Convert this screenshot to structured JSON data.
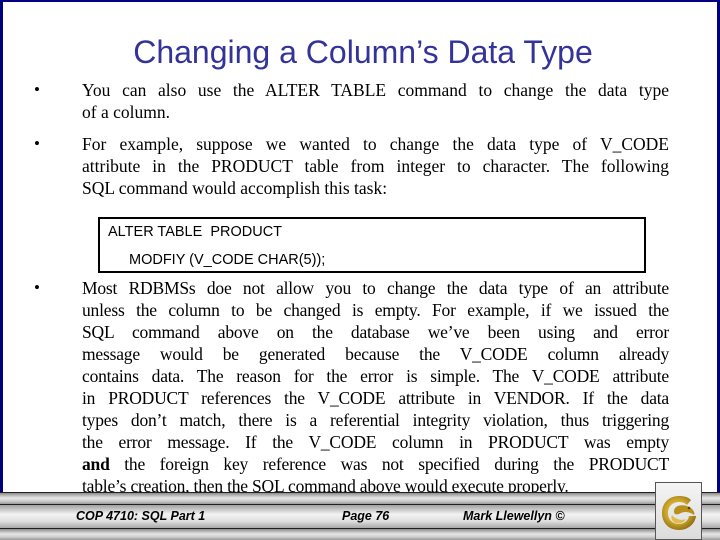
{
  "slide": {
    "title": "Changing a Column’s Data Type",
    "bullet_glyph": "•",
    "bullets": [
      {
        "lines": [
          "You can also use the ALTER TABLE command to change the data type",
          "of a column."
        ]
      },
      {
        "lines": [
          "For example, suppose we wanted to change the data type of V_CODE",
          "attribute in the PRODUCT table from integer to character.  The following",
          "SQL command would accomplish this task:"
        ]
      },
      {
        "lines": [
          "Most RDBMSs doe not allow you to change the data type of an attribute",
          "unless the column to be changed is empty.  For example, if we issued the",
          "SQL command above on the database we’ve been using and error",
          "message would be generated because the V_CODE column already",
          "contains data.  The reason for the error is simple.  The V_CODE attribute",
          "in PRODUCT references the V_CODE attribute in VENDOR.  If the data",
          "types don’t match, there is a referential integrity violation, thus triggering",
          "the error message.  If the V_CODE column in PRODUCT was empty"
        ],
        "bold_word": "and",
        "line9_rest": " the foreign key reference was not specified during the PRODUCT",
        "line10": "table’s creation, then the SQL command above would execute properly."
      }
    ],
    "code": {
      "line1": "ALTER TABLE  PRODUCT",
      "line2": "MODFIY (V_CODE CHAR(5));"
    }
  },
  "footer": {
    "course": "COP 4710: SQL Part 1",
    "page": "Page 76",
    "author": "Mark Llewellyn ©",
    "logo_icon": "ucf-pegasus-logo"
  },
  "colors": {
    "title": "#333399",
    "border": "#000080",
    "logo_gold": "#c9a227"
  }
}
